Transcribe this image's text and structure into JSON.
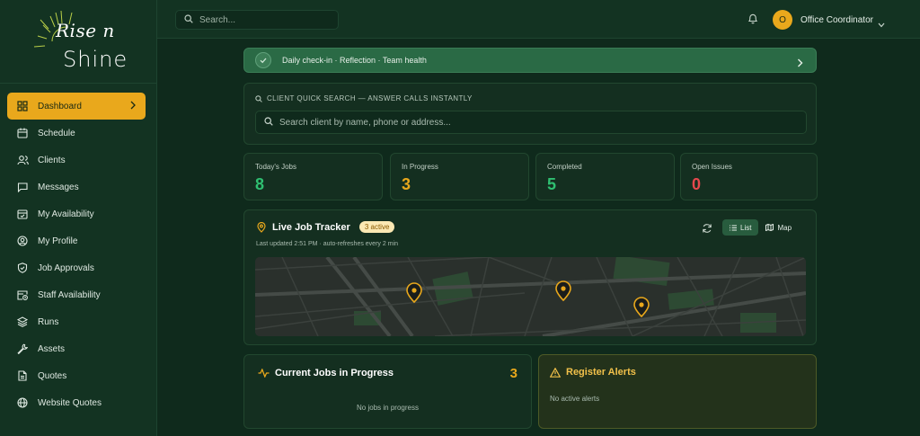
{
  "brand": {
    "line1": "Rise n",
    "line2": "Shine"
  },
  "sidebar": {
    "items": [
      {
        "label": "Dashboard",
        "icon": "grid-icon",
        "active": true
      },
      {
        "label": "Schedule",
        "icon": "calendar-icon"
      },
      {
        "label": "Clients",
        "icon": "users-icon"
      },
      {
        "label": "Messages",
        "icon": "message-icon"
      },
      {
        "label": "My Availability",
        "icon": "calendar-check-icon"
      },
      {
        "label": "My Profile",
        "icon": "user-circle-icon"
      },
      {
        "label": "Job Approvals",
        "icon": "shield-check-icon"
      },
      {
        "label": "Staff Availability",
        "icon": "calendar-clock-icon"
      },
      {
        "label": "Runs",
        "icon": "layers-icon"
      },
      {
        "label": "Assets",
        "icon": "wrench-icon"
      },
      {
        "label": "Quotes",
        "icon": "file-icon"
      },
      {
        "label": "Website Quotes",
        "icon": "globe-icon"
      }
    ]
  },
  "topbar": {
    "search_placeholder": "Search...",
    "avatar_initial": "O",
    "user_name": "Office Coordinator"
  },
  "banner": {
    "text": "Daily check-in · Reflection · Team health"
  },
  "quick_search": {
    "title": "CLIENT QUICK SEARCH — ANSWER CALLS INSTANTLY",
    "placeholder": "Search client by name, phone or address..."
  },
  "stats": [
    {
      "label": "Today's Jobs",
      "value": "8",
      "color": "#2fbf71"
    },
    {
      "label": "In Progress",
      "value": "3",
      "color": "#e9a81c"
    },
    {
      "label": "Completed",
      "value": "5",
      "color": "#2fbf71"
    },
    {
      "label": "Open Issues",
      "value": "0",
      "color": "#e5484d"
    }
  ],
  "tracker": {
    "title": "Live Job Tracker",
    "badge": "3 active",
    "subtitle": "Last updated 2:51 PM · auto-refreshes every 2 min",
    "toggle_list": "List",
    "toggle_map": "Map"
  },
  "current_jobs": {
    "title": "Current Jobs in Progress",
    "count": "3",
    "empty": "No jobs in progress"
  },
  "register_alerts": {
    "title": "Register Alerts",
    "empty": "No active alerts"
  },
  "colors": {
    "accent": "#e9a81c",
    "green": "#2fbf71",
    "red": "#e5484d"
  }
}
